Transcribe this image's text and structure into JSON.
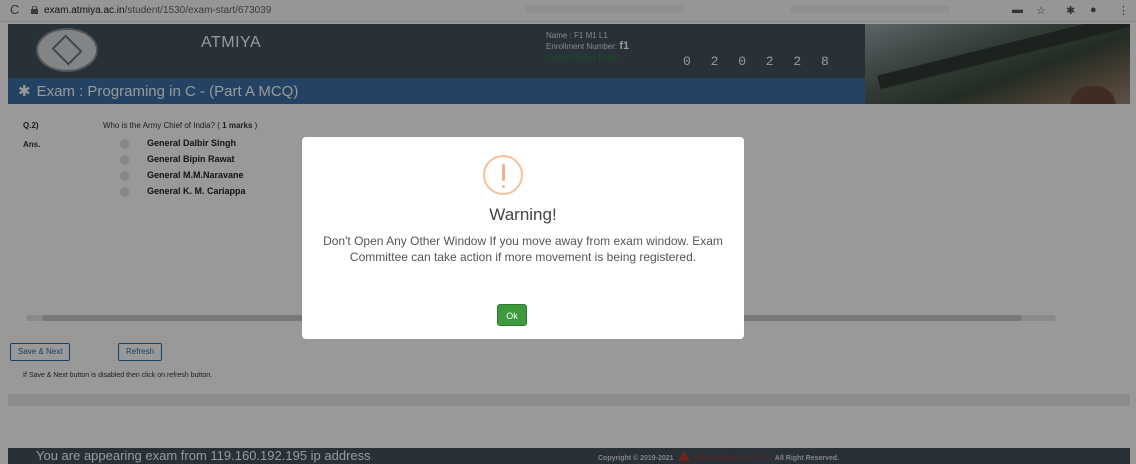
{
  "browser": {
    "url_host": "exam.atmiya.ac.in",
    "url_path": "/student/1530/exam-start/673039"
  },
  "header": {
    "brand": "ATMIYA",
    "name_label": "Name : F1 M1 L1",
    "enrollment_label": "Enrollment Number:",
    "enrollment_value": "f1",
    "timer_label": "Current Exam Timer:",
    "timer": "0 2 0 2 2 8"
  },
  "exam": {
    "title": "Exam : Programing in C - (Part A MCQ)"
  },
  "question": {
    "number": "Q.2)",
    "text_prefix": "Who is the Army Chief of India? (",
    "marks": "1 marks",
    "text_suffix": ")",
    "answer_label": "Ans.",
    "options": [
      "General Dalbir Singh",
      "General Bipin Rawat",
      "General M.M.Naravane",
      "General K. M. Cariappa"
    ]
  },
  "actions": {
    "save_next": "Save & Next",
    "refresh": "Refresh",
    "note": "If Save & Next button is disabled then click on refresh button."
  },
  "footer": {
    "ip_text": "You are appearing exam from 119.160.192.195 ip address",
    "copyright": "Copyright © 2019-2021",
    "company": "Infinity Infoway PVT. LTD.",
    "rights": "All Right Reserved."
  },
  "modal": {
    "title": "Warning!",
    "message": "Don't Open Any Other Window If you move away from exam window. Exam Committee can take action if more movement is being registered.",
    "ok_label": "Ok"
  },
  "colors": {
    "header_bg": "#44515e",
    "exam_bar": "#3c6fa5",
    "ok_green": "#3c9a3c",
    "warning_orange": "#f5c199"
  }
}
